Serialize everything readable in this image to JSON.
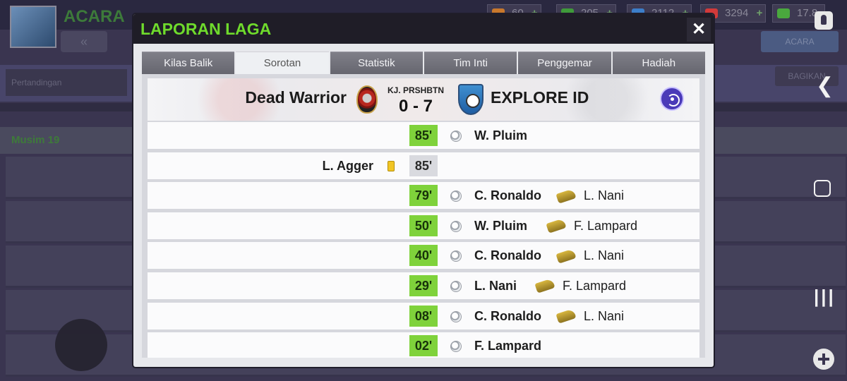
{
  "background": {
    "title": "ACARA",
    "resources": [
      {
        "value": "60",
        "color": "#c8782c"
      },
      {
        "value": "205",
        "color": "#3f9a3a"
      },
      {
        "value": "2112",
        "color": "#3c7ec9"
      },
      {
        "value": "3294",
        "color": "#d23a3a"
      },
      {
        "value": "17.8",
        "color": "#4aa83e"
      }
    ],
    "section_label": "Pertandingan",
    "green_row_label": "Musim 19",
    "right_button": "ACARA",
    "right_button2": "BAGIKAN"
  },
  "modal": {
    "title": "LAPORAN LAGA",
    "close_label": "✕",
    "tabs": [
      "Kilas Balik",
      "Sorotan",
      "Statistik",
      "Tim Inti",
      "Penggemar",
      "Hadiah"
    ],
    "active_tab": "Sorotan"
  },
  "match": {
    "home_team": "Dead Warrior",
    "away_team": "EXPLORE ID",
    "competition": "KJ. PRSHBTN",
    "score": "0 - 7"
  },
  "events": [
    {
      "type": "goal",
      "minute": "85'",
      "scorer": "W. Pluim",
      "assist": ""
    },
    {
      "type": "card",
      "minute": "85'",
      "player": "L. Agger",
      "card": "yellow"
    },
    {
      "type": "goal",
      "minute": "79'",
      "scorer": "C. Ronaldo",
      "assist": "L. Nani"
    },
    {
      "type": "goal",
      "minute": "50'",
      "scorer": "W. Pluim",
      "assist": "F. Lampard"
    },
    {
      "type": "goal",
      "minute": "40'",
      "scorer": "C. Ronaldo",
      "assist": "L. Nani"
    },
    {
      "type": "goal",
      "minute": "29'",
      "scorer": "L. Nani",
      "assist": "F. Lampard"
    },
    {
      "type": "goal",
      "minute": "08'",
      "scorer": "C. Ronaldo",
      "assist": "L. Nani"
    },
    {
      "type": "goal",
      "minute": "02'",
      "scorer": "F. Lampard",
      "assist": ""
    }
  ],
  "colors": {
    "title_green": "#6fdb2c",
    "minute_green": "#7fd23b",
    "yellow_card": "#f1c524",
    "toggle_purple": "#4a3ab8"
  }
}
